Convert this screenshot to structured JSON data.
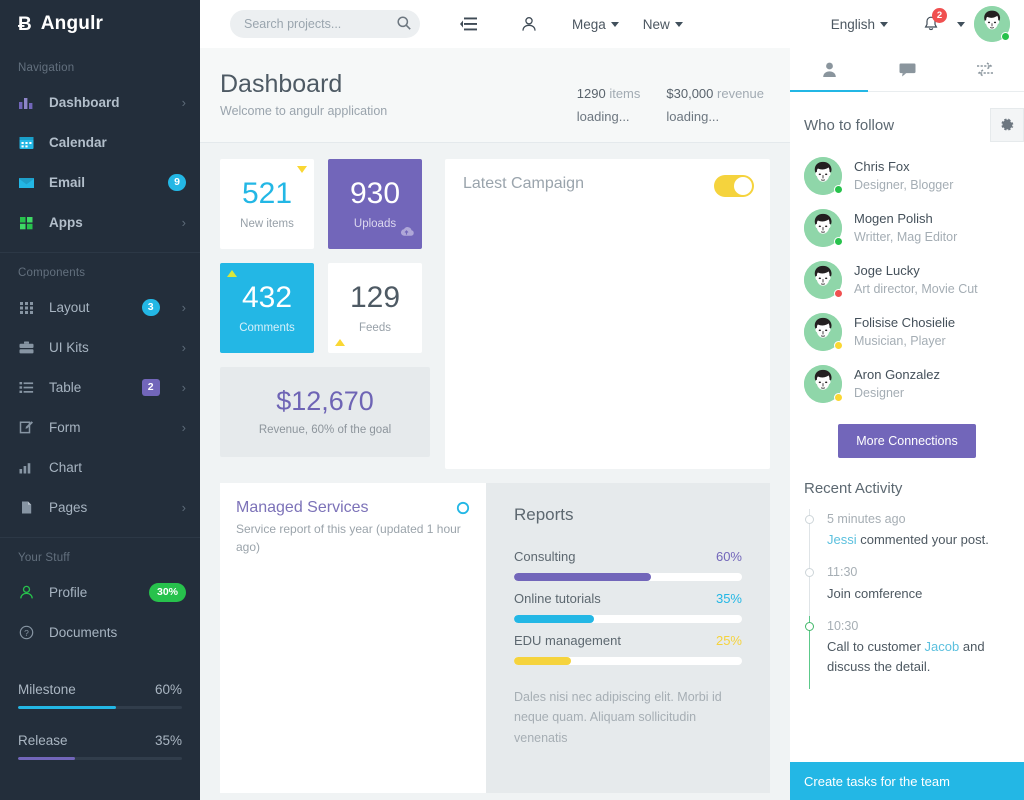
{
  "brand": {
    "mark": "Ƀ",
    "name": "Angulr"
  },
  "sidebar": {
    "nav_title": "Navigation",
    "nav_items": [
      {
        "label": "Dashboard",
        "icon": "bar-chart-icon",
        "chevron": "›",
        "badge": null
      },
      {
        "label": "Calendar",
        "icon": "calendar-icon",
        "chevron": "",
        "badge": null
      },
      {
        "label": "Email",
        "icon": "envelope-icon",
        "chevron": "",
        "badge": "9",
        "badge_type": "info"
      },
      {
        "label": "Apps",
        "icon": "grid-apps-icon",
        "chevron": "›",
        "badge": null
      }
    ],
    "components_title": "Components",
    "component_items": [
      {
        "label": "Layout",
        "icon": "dots-grid-icon",
        "chevron": "›",
        "badge": "3",
        "badge_type": "info"
      },
      {
        "label": "UI Kits",
        "icon": "briefcase-icon",
        "chevron": "›",
        "badge": null
      },
      {
        "label": "Table",
        "icon": "list-icon",
        "chevron": "›",
        "badge": "2",
        "badge_type": "purple"
      },
      {
        "label": "Form",
        "icon": "edit-square-icon",
        "chevron": "›",
        "badge": null
      },
      {
        "label": "Chart",
        "icon": "chart-bars-icon",
        "chevron": "",
        "badge": null
      },
      {
        "label": "Pages",
        "icon": "file-icon",
        "chevron": "›",
        "badge": null
      }
    ],
    "stuff_title": "Your Stuff",
    "stuff_items": [
      {
        "label": "Profile",
        "icon": "user-outline-icon",
        "badge": "30%",
        "badge_type": "green"
      },
      {
        "label": "Documents",
        "icon": "question-circle-icon",
        "badge": null
      }
    ],
    "meters": [
      {
        "label": "Milestone",
        "value": "60%",
        "pct": 60,
        "color": "#23b7e5"
      },
      {
        "label": "Release",
        "value": "35%",
        "pct": 35,
        "color": "#7266ba"
      }
    ]
  },
  "topbar": {
    "search_placeholder": "Search projects...",
    "search_value": "",
    "toggle_icon": "list-collapse-icon",
    "user_icon": "user-icon",
    "mega_label": "Mega",
    "new_label": "New",
    "language_label": "English",
    "notification_icon": "bell-icon",
    "notification_count": "2",
    "avatar_name": "avatar"
  },
  "page": {
    "title": "Dashboard",
    "subtitle": "Welcome to angulr application",
    "stats": [
      {
        "value": "1290",
        "unit": "items",
        "status": "loading..."
      },
      {
        "value": "$30,000",
        "unit": "revenue",
        "status": "loading..."
      }
    ]
  },
  "tiles": [
    {
      "number": "521",
      "label": "New items",
      "style": "white",
      "num_color": "#23b7e5",
      "label_color": "#97a0a8",
      "marker": "down-tr",
      "corner_icon": null
    },
    {
      "number": "930",
      "label": "Uploads",
      "style": "purple",
      "num_color": "#ffffff",
      "label_color": "#dcd8ef",
      "marker": null,
      "corner_icon": "cloud-upload-icon"
    },
    {
      "number": "432",
      "label": "Comments",
      "style": "info",
      "num_color": "#ffffff",
      "label_color": "#d6f0fa",
      "marker": "up-tl",
      "corner_icon": null
    },
    {
      "number": "129",
      "label": "Feeds",
      "style": "white",
      "num_color": "#4e5a64",
      "label_color": "#97a0a8",
      "marker": "up-bl",
      "corner_icon": null
    }
  ],
  "revenue": {
    "amount": "$12,670",
    "caption": "Revenue, 60% of the goal"
  },
  "campaign": {
    "title": "Latest Campaign",
    "toggle_on": true
  },
  "managed": {
    "title": "Managed Services",
    "subtitle": "Service report of this year (updated 1 hour ago)",
    "spinner_icon": "loading-circle-icon"
  },
  "reports": {
    "title": "Reports",
    "rows": [
      {
        "label": "Consulting",
        "value": "60%",
        "pct": 60,
        "color": "#7266ba"
      },
      {
        "label": "Online tutorials",
        "value": "35%",
        "pct": 35,
        "color": "#23b7e5"
      },
      {
        "label": "EDU management",
        "value": "25%",
        "pct": 25,
        "color": "#f5d33d"
      }
    ],
    "note": "Dales nisi nec adipiscing elit. Morbi id neque quam. Aliquam sollicitudin venenatis"
  },
  "rightbar": {
    "tabs": [
      {
        "icon": "user-icon",
        "active": true
      },
      {
        "icon": "chat-bubble-icon",
        "active": false
      },
      {
        "icon": "exchange-arrows-icon",
        "active": false
      }
    ],
    "follow_title": "Who to follow",
    "settings_icon": "gear-icon",
    "people": [
      {
        "name": "Chris Fox",
        "role": "Designer, Blogger",
        "status": "#27c24c"
      },
      {
        "name": "Mogen Polish",
        "role": "Writter, Mag Editor",
        "status": "#27c24c"
      },
      {
        "name": "Joge Lucky",
        "role": "Art director, Movie Cut",
        "status": "#f05050"
      },
      {
        "name": "Folisise Chosielie",
        "role": "Musician, Player",
        "status": "#fad733"
      },
      {
        "name": "Aron Gonzalez",
        "role": "Designer",
        "status": "#fad733"
      }
    ],
    "more_label": "More Connections",
    "activity_title": "Recent Activity",
    "activities": [
      {
        "time": "5 minutes ago",
        "link": "Jessi",
        "text_after": " commented your post.",
        "text_before": "",
        "green": false
      },
      {
        "time": "11:30",
        "link": "",
        "text_before": "Join comference",
        "text_after": "",
        "green": false
      },
      {
        "time": "10:30",
        "link": "Jacob",
        "text_before": "Call to customer ",
        "text_after": " and discuss the detail.",
        "green": true
      }
    ],
    "task_bar_label": "Create tasks for the team"
  }
}
